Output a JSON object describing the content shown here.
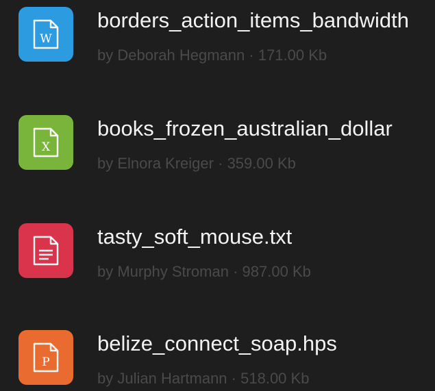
{
  "files": [
    {
      "name": "borders_action_items_bandwidth",
      "author": "by Deborah Hegmann",
      "separator": "·",
      "size": "171.00 Kb",
      "icon": "word-document-icon",
      "icon_letter": "W",
      "color": "#2c9be0"
    },
    {
      "name": "books_frozen_australian_dollar",
      "author": "by Elnora Kreiger",
      "separator": "·",
      "size": "359.00 Kb",
      "icon": "excel-spreadsheet-icon",
      "icon_letter": "X",
      "color": "#79b53a"
    },
    {
      "name": "tasty_soft_mouse.txt",
      "author": "by Murphy Stroman",
      "separator": "·",
      "size": "987.00 Kb",
      "icon": "text-document-icon",
      "icon_letter": "",
      "color": "#d9344b"
    },
    {
      "name": "belize_connect_soap.hps",
      "author": "by Julian Hartmann",
      "separator": "·",
      "size": "518.00 Kb",
      "icon": "powerpoint-presentation-icon",
      "icon_letter": "P",
      "color": "#ea6b2f"
    }
  ]
}
